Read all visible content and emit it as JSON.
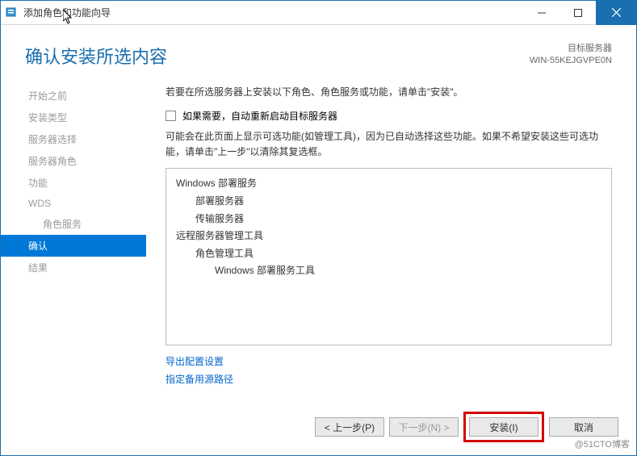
{
  "window": {
    "title": "添加角色和功能向导"
  },
  "header": {
    "heading": "确认安装所选内容",
    "target_label": "目标服务器",
    "target_server": "WIN-55KEJGVPE0N"
  },
  "sidebar": {
    "items": [
      {
        "label": "开始之前",
        "active": false,
        "indent": false
      },
      {
        "label": "安装类型",
        "active": false,
        "indent": false
      },
      {
        "label": "服务器选择",
        "active": false,
        "indent": false
      },
      {
        "label": "服务器角色",
        "active": false,
        "indent": false
      },
      {
        "label": "功能",
        "active": false,
        "indent": false
      },
      {
        "label": "WDS",
        "active": false,
        "indent": false
      },
      {
        "label": "角色服务",
        "active": false,
        "indent": true
      },
      {
        "label": "确认",
        "active": true,
        "indent": false
      },
      {
        "label": "结果",
        "active": false,
        "indent": false
      }
    ]
  },
  "content": {
    "intro": "若要在所选服务器上安装以下角色、角色服务或功能，请单击\"安装\"。",
    "restart_checkbox_label": "如果需要，自动重新启动目标服务器",
    "restart_checked": false,
    "note": "可能会在此页面上显示可选功能(如管理工具)，因为已自动选择这些功能。如果不希望安装这些可选功能，请单击\"上一步\"以清除其复选框。",
    "features": [
      {
        "text": "Windows 部署服务",
        "level": 0
      },
      {
        "text": "部署服务器",
        "level": 1
      },
      {
        "text": "传输服务器",
        "level": 1
      },
      {
        "text": "远程服务器管理工具",
        "level": 0
      },
      {
        "text": "角色管理工具",
        "level": 1
      },
      {
        "text": "Windows 部署服务工具",
        "level": 2
      }
    ],
    "links": {
      "export": "导出配置设置",
      "alternate_source": "指定备用源路径"
    }
  },
  "footer": {
    "previous": "< 上一步(P)",
    "next": "下一步(N) >",
    "install": "安装(I)",
    "cancel": "取消"
  },
  "watermark": "@51CTO博客"
}
